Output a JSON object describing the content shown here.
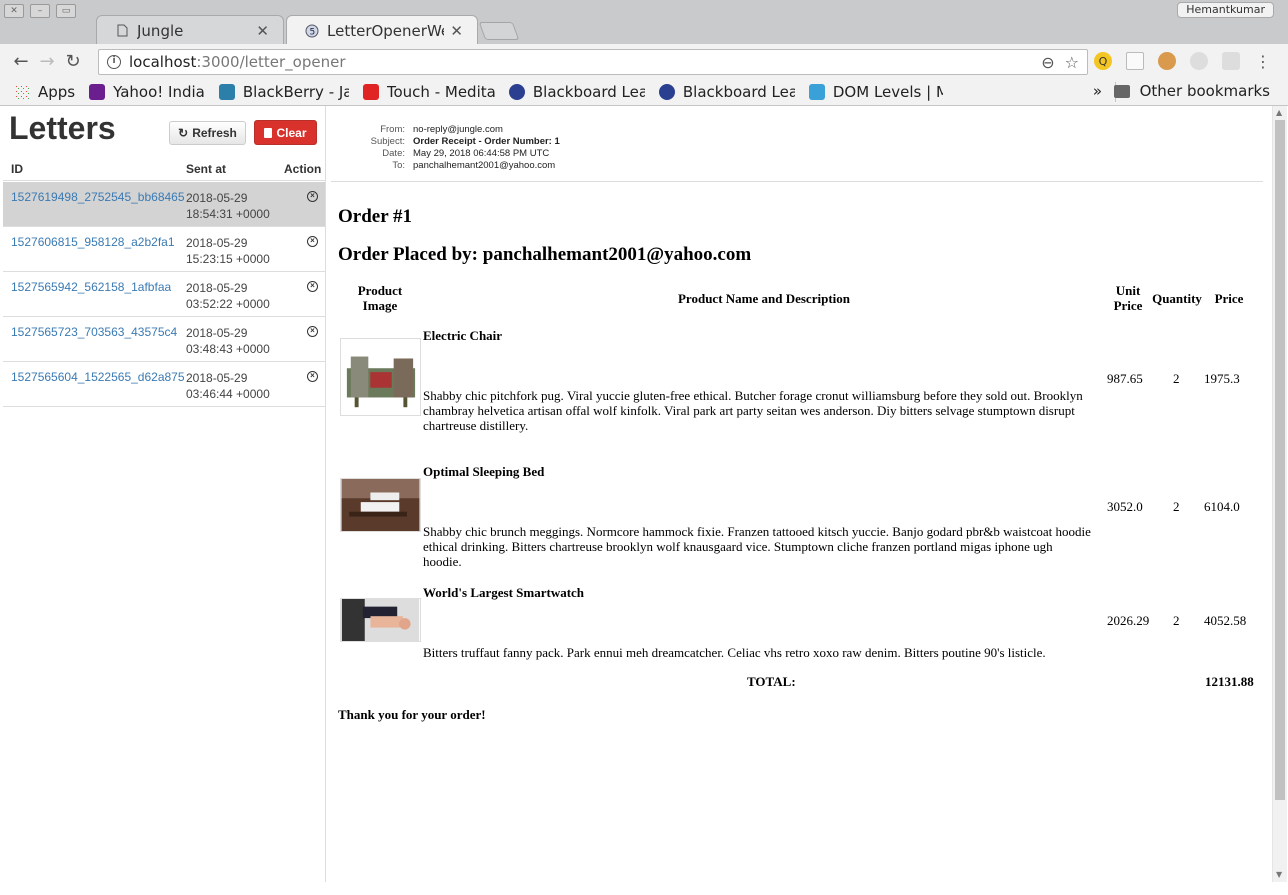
{
  "browser": {
    "tabs": [
      {
        "title": "Jungle",
        "icon": "page-icon"
      },
      {
        "title": "LetterOpenerWeb",
        "icon": "letter-opener-favicon"
      }
    ],
    "profile": "Hemantkumar",
    "url_host": "localhost",
    "url_path": ":3000/letter_opener",
    "bookmarks": [
      {
        "label": "Apps",
        "icon": "apps-grid-icon"
      },
      {
        "label": "Yahoo! India",
        "icon": "yahoo-icon"
      },
      {
        "label": "BlackBerry - Jav",
        "icon": "blackberry-icon"
      },
      {
        "label": "Touch - Meditati",
        "icon": "youtube-icon"
      },
      {
        "label": "Blackboard Lear",
        "icon": "blackboard-icon"
      },
      {
        "label": "Blackboard Lear",
        "icon": "blackboard-icon"
      },
      {
        "label": "DOM Levels | MI",
        "icon": "dom-icon"
      }
    ],
    "more": "»",
    "other_bookmarks": "Other bookmarks"
  },
  "sidebar": {
    "title": "Letters",
    "refresh_label": "Refresh",
    "clear_label": "Clear",
    "col_id": "ID",
    "col_sent": "Sent at",
    "col_action": "Action",
    "letters": [
      {
        "id": "1527619498_2752545_bb68465",
        "date": "2018-05-29",
        "time": "18:54:31 +0000"
      },
      {
        "id": "1527606815_958128_a2b2fa1",
        "date": "2018-05-29",
        "time": "15:23:15 +0000"
      },
      {
        "id": "1527565942_562158_1afbfaa",
        "date": "2018-05-29",
        "time": "03:52:22 +0000"
      },
      {
        "id": "1527565723_703563_43575c4",
        "date": "2018-05-29",
        "time": "03:48:43 +0000"
      },
      {
        "id": "1527565604_1522565_d62a875",
        "date": "2018-05-29",
        "time": "03:46:44 +0000"
      }
    ]
  },
  "email": {
    "from_label": "From:",
    "from": "no-reply@jungle.com",
    "subject_label": "Subject:",
    "subject": "Order Receipt - Order Number: 1",
    "date_label": "Date:",
    "date": "May 29, 2018 06:44:58 PM UTC",
    "to_label": "To:",
    "to": "panchalhemant2001@yahoo.com",
    "heading1": "Order #1",
    "heading2": "Order Placed by: panchalhemant2001@yahoo.com",
    "col_image": "Product Image",
    "col_name": "Product Name and Description",
    "col_unit": "Unit Price",
    "col_qty": "Quantity",
    "col_price": "Price",
    "items": [
      {
        "name": "Electric Chair",
        "desc": "Shabby chic pitchfork pug. Viral yuccie gluten-free ethical. Butcher forage cronut williamsburg before they sold out. Brooklyn chambray helvetica artisan offal wolf kinfolk. Viral park art party seitan wes anderson. Diy bitters selvage stumptown disrupt chartreuse distillery.",
        "unit": "987.65",
        "qty": "2",
        "price": "1975.3"
      },
      {
        "name": "Optimal Sleeping Bed",
        "desc": "Shabby chic brunch meggings. Normcore hammock fixie. Franzen tattooed kitsch yuccie. Banjo godard pbr&b waistcoat hoodie ethical drinking. Bitters chartreuse brooklyn wolf knausgaard vice. Stumptown cliche franzen portland migas iphone ugh hoodie.",
        "unit": "3052.0",
        "qty": "2",
        "price": "6104.0"
      },
      {
        "name": "World's Largest Smartwatch",
        "desc": "Bitters truffaut fanny pack. Park ennui meh dreamcatcher. Celiac vhs retro xoxo raw denim. Bitters poutine 90's listicle.",
        "unit": "2026.29",
        "qty": "2",
        "price": "4052.58"
      }
    ],
    "total_label": "TOTAL:",
    "total": "12131.88",
    "thanks": "Thank you for your order!"
  }
}
